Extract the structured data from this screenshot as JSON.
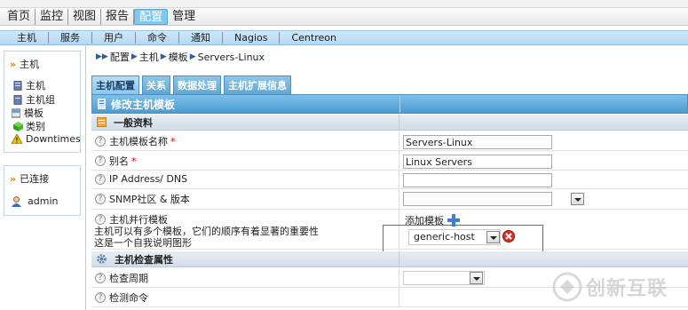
{
  "main_nav": [
    "首页",
    "监控",
    "视图",
    "报告",
    "配置",
    "管理"
  ],
  "main_nav_active_index": 4,
  "sub_nav": [
    "主机",
    "服务",
    "用户",
    "命令",
    "通知",
    "Nagios",
    "Centreon"
  ],
  "left_panel": {
    "title": "主机",
    "items": [
      {
        "label": "主机",
        "icon": "server-icon"
      },
      {
        "label": "主机组",
        "icon": "server-group-icon"
      },
      {
        "label": "模板",
        "icon": "template-icon"
      },
      {
        "label": "类别",
        "icon": "category-cube-icon"
      },
      {
        "label": "Downtimes",
        "icon": "warning-icon"
      }
    ]
  },
  "connected_panel": {
    "title": "已连接",
    "users": [
      {
        "label": "admin",
        "icon": "user-icon"
      }
    ]
  },
  "breadcrumb": [
    "配置",
    "主机",
    "模板",
    "Servers-Linux"
  ],
  "tabs": [
    "主机配置",
    "关系",
    "数据处理",
    "主机扩展信息"
  ],
  "active_tab_index": 0,
  "form_title": "修改主机模板",
  "section_general": "一般资料",
  "fields": {
    "template_name": {
      "label": "主机模板名称",
      "required": "*",
      "value": "Servers-Linux"
    },
    "alias": {
      "label": "别名",
      "required": "*",
      "value": "Linux Servers"
    },
    "ip": {
      "label": "IP Address/ DNS",
      "value": ""
    },
    "snmp": {
      "label": "SNMP社区 & 版本",
      "value": ""
    },
    "parallel_template": {
      "label": "主机并行模板",
      "desc_line1": "主机可以有多个模板，它们的顺序有着显著的重要性",
      "desc_line2": "这是一个自我说明图形",
      "add_label": "添加模板",
      "selected": "generic-host"
    }
  },
  "section_check": "主机检查属性",
  "check_fields": {
    "period": {
      "label": "检查周期",
      "value": ""
    },
    "command": {
      "label": "检测命令",
      "value": ""
    }
  },
  "colors": {
    "accent": "#5ea6d3",
    "active_nav": "#7fc8ee",
    "highlight_box": "#e03a3a"
  },
  "watermark": "创新互联"
}
